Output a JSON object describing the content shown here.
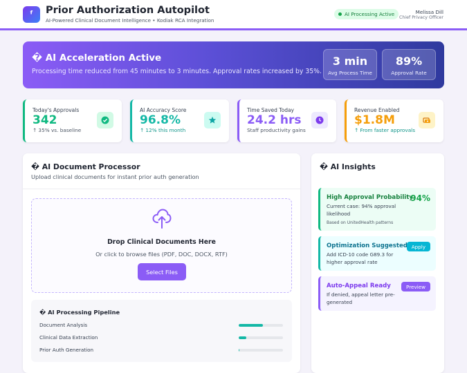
{
  "header": {
    "logo_glyph": "ᶠ",
    "title": "Prior Authorization Autopilot",
    "subtitle": "AI-Powered Clinical Document Intelligence • Kodiak RCA Integration",
    "status": "AI Processing Active",
    "user_name": "Melissa Dill",
    "user_role": "Chief Privacy Officer"
  },
  "banner": {
    "title": "� AI Acceleration Active",
    "text": "Processing time reduced from 45 minutes to 3 minutes. Approval rates increased by 35%.",
    "stats": [
      {
        "value": "3 min",
        "label": "Avg Process Time"
      },
      {
        "value": "89%",
        "label": "Approval Rate"
      }
    ]
  },
  "metrics": [
    {
      "label": "Today's Approvals",
      "value": "342",
      "sub": "↑ 35% vs. baseline",
      "icon": "check-icon",
      "color": "#10b981",
      "sub_color": "#4b5563"
    },
    {
      "label": "AI Accuracy Score",
      "value": "96.8%",
      "sub": "↑ 12% this month",
      "icon": "star-icon",
      "color": "#14b8a6",
      "sub_color": "#0d9488"
    },
    {
      "label": "Time Saved Today",
      "value": "24.2 hrs",
      "sub": "Staff productivity gains",
      "icon": "clock-icon",
      "color": "#8b5cf6",
      "sub_color": "#4b5563"
    },
    {
      "label": "Revenue Enabled",
      "value": "$1.8M",
      "sub": "↑ From faster approvals",
      "icon": "money-icon",
      "color": "#f59e0b",
      "sub_color": "#0d9488"
    }
  ],
  "processor": {
    "title": "� AI Document Processor",
    "subtitle": "Upload clinical documents for instant prior auth generation",
    "drop_title": "Drop Clinical Documents Here",
    "drop_text": "Or click to browse files (PDF, DOC, DOCX, RTF)",
    "select_label": "Select Files"
  },
  "pipeline": {
    "title": "� AI Processing Pipeline",
    "steps": [
      {
        "label": "Document Analysis",
        "progress": 0.55
      },
      {
        "label": "Clinical Data Extraction",
        "progress": 0.17
      },
      {
        "label": "Prior Auth Generation",
        "progress": 0.02
      }
    ]
  },
  "insights": {
    "title": "� AI Insights",
    "cards": [
      {
        "title": "High Approval Probability",
        "value": "94%",
        "body": "Current case: 94% approval likelihood",
        "note": "Based on UnitedHealth patterns"
      },
      {
        "title": "Optimization Suggested",
        "button": "Apply",
        "body": "Add ICD-10 code G89.3 for higher approval rate"
      },
      {
        "title": "Auto-Appeal Ready",
        "button": "Preview",
        "body": "If denied, appeal letter pre-generated"
      }
    ]
  },
  "colors": {
    "accent": "#8b5cf6",
    "success": "#16a34a",
    "teal": "#14b8a6",
    "amber": "#f59e0b"
  }
}
